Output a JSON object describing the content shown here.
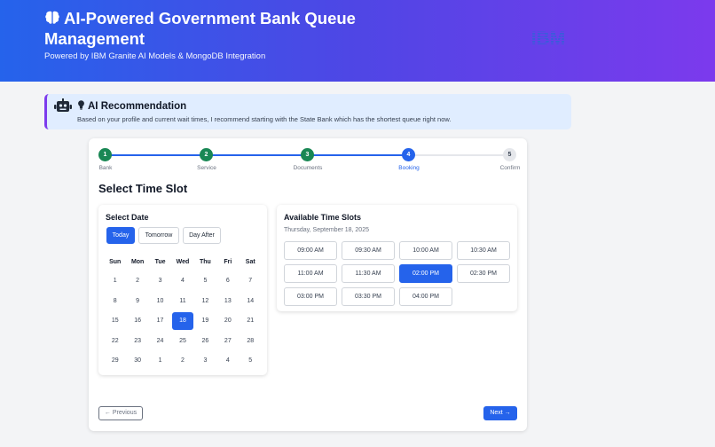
{
  "header": {
    "title": "AI-Powered Government Bank Queue Management",
    "subtitle": "Powered by IBM Granite AI Models & MongoDB Integration",
    "logo_text": "IBM",
    "gradient_start": "#2563eb",
    "gradient_end": "#7c3aed"
  },
  "ai": {
    "title": "AI Recommendation",
    "text": "Based on your profile and current wait times, I recommend starting with the State Bank which has the shortest queue right now."
  },
  "stepper": {
    "current_step": 4,
    "steps": [
      {
        "num": "1",
        "label": "Bank",
        "state": "done"
      },
      {
        "num": "2",
        "label": "Service",
        "state": "done"
      },
      {
        "num": "3",
        "label": "Documents",
        "state": "done"
      },
      {
        "num": "4",
        "label": "Booking",
        "state": "active"
      },
      {
        "num": "5",
        "label": "Confirm",
        "state": "pending"
      }
    ]
  },
  "section_title": "Select Time Slot",
  "date_panel": {
    "title": "Select Date",
    "quick": [
      {
        "label": "Today",
        "active": true
      },
      {
        "label": "Tomorrow",
        "active": false
      },
      {
        "label": "Day After",
        "active": false
      }
    ],
    "weekdays": [
      "Sun",
      "Mon",
      "Tue",
      "Wed",
      "Thu",
      "Fri",
      "Sat"
    ],
    "weeks": [
      [
        "1",
        "2",
        "3",
        "4",
        "5",
        "6",
        "7"
      ],
      [
        "8",
        "9",
        "10",
        "11",
        "12",
        "13",
        "14"
      ],
      [
        "15",
        "16",
        "17",
        "18",
        "19",
        "20",
        "21"
      ],
      [
        "22",
        "23",
        "24",
        "25",
        "26",
        "27",
        "28"
      ],
      [
        "29",
        "30",
        "1",
        "2",
        "3",
        "4",
        "5"
      ]
    ],
    "selected_day": "18"
  },
  "slots_panel": {
    "title": "Available Time Slots",
    "date": "Thursday, September 18, 2025",
    "slots": [
      "09:00 AM",
      "09:30 AM",
      "10:00 AM",
      "10:30 AM",
      "11:00 AM",
      "11:30 AM",
      "02:00 PM",
      "02:30 PM",
      "03:00 PM",
      "03:30 PM",
      "04:00 PM"
    ],
    "selected": "02:00 PM"
  },
  "nav": {
    "previous": "Previous",
    "next": "Next"
  },
  "colors": {
    "primary": "#2563eb",
    "success": "#198754",
    "pending": "#e5e7eb"
  }
}
